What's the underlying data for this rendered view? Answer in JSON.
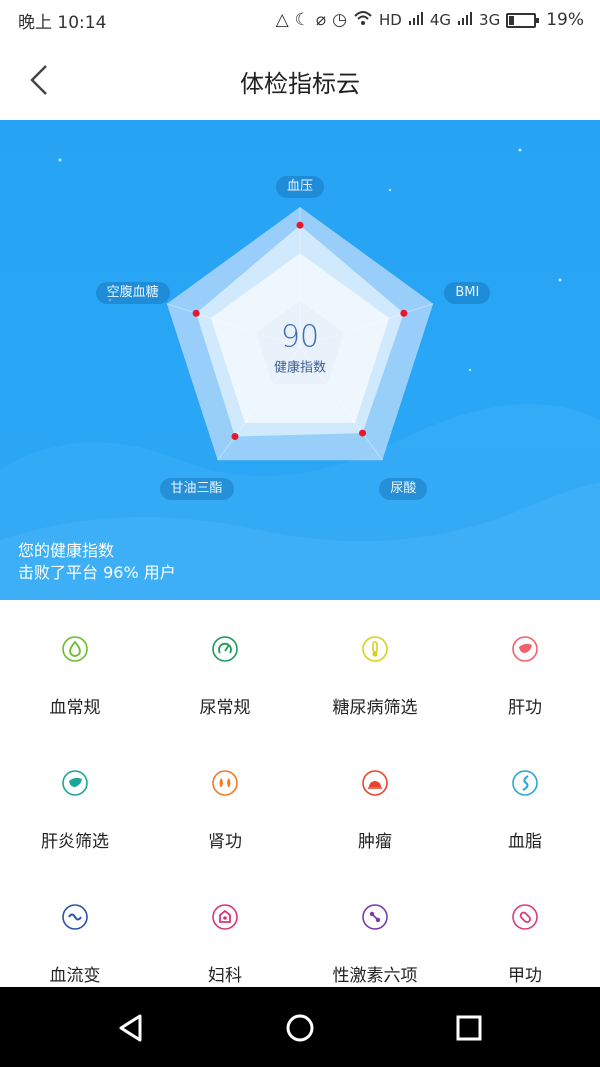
{
  "status": {
    "time": "晚上 10:14",
    "hd": "HD",
    "net1": "4G",
    "net2": "3G",
    "battery": "19%",
    "battery_level": 0.19,
    "icons": [
      "location-icon",
      "moon-icon",
      "alarm-mute-icon",
      "alarm-icon",
      "wifi-icon",
      "signal-icon",
      "signal-icon",
      "battery-icon"
    ]
  },
  "nav": {
    "title": "体检指标云",
    "back_icon": "chevron-left-icon"
  },
  "radar": {
    "score": "90",
    "score_label": "健康指数",
    "axes": [
      "血压",
      "BMI",
      "尿酸",
      "甘油三酯",
      "空腹血糖"
    ],
    "values": [
      0.87,
      0.78,
      0.76,
      0.79,
      0.78
    ],
    "colors": {
      "accent": "#2aa6f6",
      "point": "#e8182c"
    }
  },
  "hero": {
    "line1": "您的健康指数",
    "line2": "击败了平台 96% 用户"
  },
  "categories": [
    {
      "label": "血常规",
      "icon": "drop-icon",
      "color": "#6cbb2c"
    },
    {
      "label": "尿常规",
      "icon": "gauge-icon",
      "color": "#1f9a5a"
    },
    {
      "label": "糖尿病筛选",
      "icon": "thermometer-icon",
      "color": "#d6d21c"
    },
    {
      "label": "肝功",
      "icon": "liver-icon",
      "color": "#f2616a"
    },
    {
      "label": "肝炎筛选",
      "icon": "liver-icon",
      "color": "#1aa59a"
    },
    {
      "label": "肾功",
      "icon": "kidney-icon",
      "color": "#f07c2a"
    },
    {
      "label": "肿瘤",
      "icon": "dome-icon",
      "color": "#e84530"
    },
    {
      "label": "血脂",
      "icon": "vessel-icon",
      "color": "#2ba4d8"
    },
    {
      "label": "血流变",
      "icon": "wave-icon",
      "color": "#2a52a8"
    },
    {
      "label": "妇科",
      "icon": "house-icon",
      "color": "#d8367a"
    },
    {
      "label": "性激素六项",
      "icon": "molecule-icon",
      "color": "#7a3aa8"
    },
    {
      "label": "甲功",
      "icon": "pill-icon",
      "color": "#e03a78"
    }
  ],
  "system_nav": {
    "back_icon": "triangle-back-icon",
    "home_icon": "circle-home-icon",
    "recents_icon": "square-recents-icon"
  }
}
